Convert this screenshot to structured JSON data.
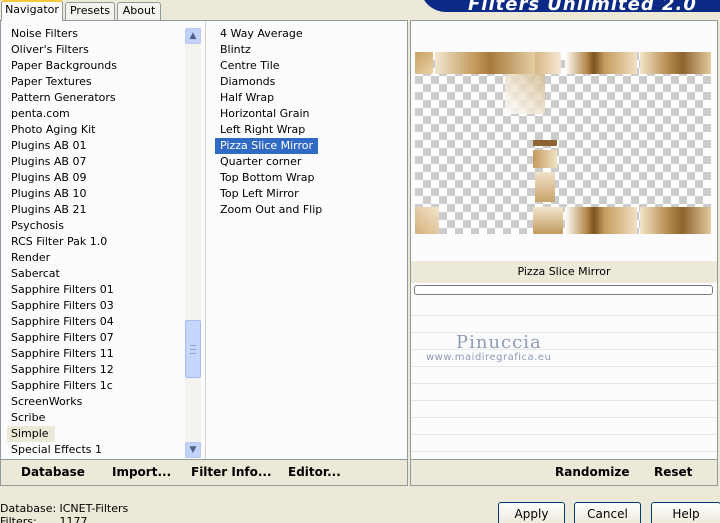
{
  "app": {
    "title": "Filters Unlimited 2.0"
  },
  "tabs": [
    {
      "label": "Navigator",
      "active": true
    },
    {
      "label": "Presets",
      "active": false
    },
    {
      "label": "About",
      "active": false
    }
  ],
  "categories": {
    "items": [
      "Noise Filters",
      "Oliver's Filters",
      "Paper Backgrounds",
      "Paper Textures",
      "Pattern Generators",
      "penta.com",
      "Photo Aging Kit",
      "Plugins AB 01",
      "Plugins AB 07",
      "Plugins AB 09",
      "Plugins AB 10",
      "Plugins AB 21",
      "Psychosis",
      "RCS Filter Pak 1.0",
      "Render",
      "Sabercat",
      "Sapphire Filters 01",
      "Sapphire Filters 03",
      "Sapphire Filters 04",
      "Sapphire Filters 07",
      "Sapphire Filters 11",
      "Sapphire Filters 12",
      "Sapphire Filters 1c",
      "ScreenWorks",
      "Scribe",
      "Simple",
      "Special Effects 1"
    ],
    "selected": "Simple"
  },
  "filters": {
    "items": [
      "4 Way Average",
      "Blintz",
      "Centre Tile",
      "Diamonds",
      "Half Wrap",
      "Horizontal Grain",
      "Left Right Wrap",
      "Pizza Slice Mirror",
      "Quarter corner",
      "Top Bottom Wrap",
      "Top Left Mirror",
      "Zoom Out and Flip"
    ],
    "selected": "Pizza Slice Mirror"
  },
  "preview": {
    "filter_name": "Pizza Slice Mirror"
  },
  "watermark": {
    "name": "Pinuccia",
    "url": "www.maidiregrafica.eu"
  },
  "left_bar": {
    "database": "Database",
    "import": "Import...",
    "filter_info": "Filter Info...",
    "editor": "Editor..."
  },
  "right_bar": {
    "randomize": "Randomize",
    "reset": "Reset"
  },
  "status": {
    "database_label": "Database:",
    "database_value": "ICNET-Filters",
    "filters_label": "Filters:",
    "filters_value": "1177"
  },
  "dialog": {
    "apply": "Apply",
    "cancel": "Cancel",
    "help": "Help"
  },
  "colors": {
    "selection": "#316ac5",
    "banner": "#0a2a86",
    "tab_highlight": "#ffc83c"
  }
}
